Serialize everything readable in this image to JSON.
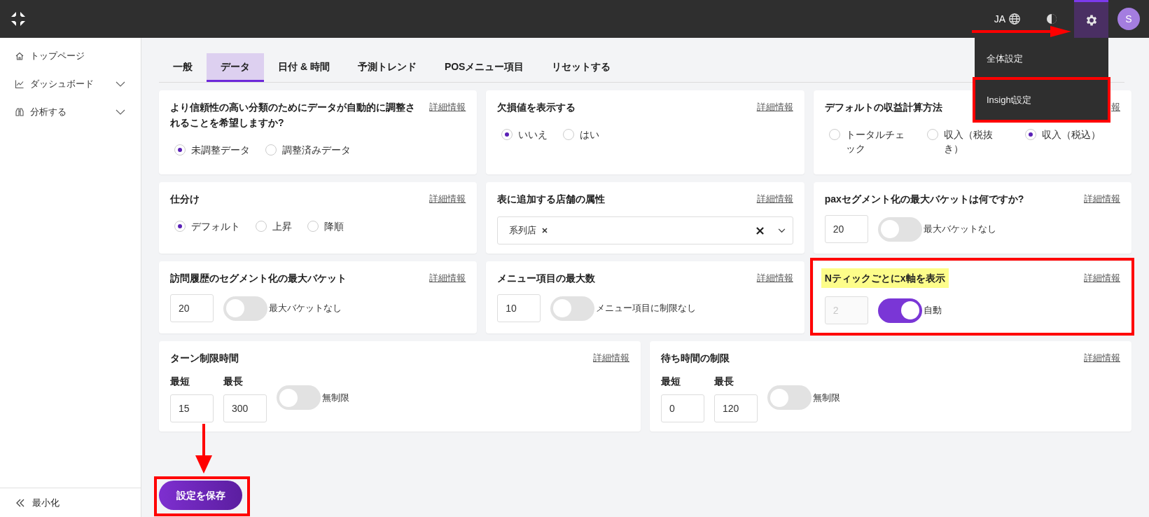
{
  "header": {
    "language": "JA",
    "avatar_initial": "S",
    "settings_menu": [
      {
        "label": "全体設定"
      },
      {
        "label": "Insight設定"
      }
    ]
  },
  "sidebar": {
    "items": [
      {
        "label": "トップページ",
        "expandable": false
      },
      {
        "label": "ダッシュボード",
        "expandable": true
      },
      {
        "label": "分析する",
        "expandable": true
      }
    ],
    "collapse_label": "最小化"
  },
  "tabs": [
    {
      "label": "一般",
      "selected": false
    },
    {
      "label": "データ",
      "selected": true
    },
    {
      "label": "日付 & 時間",
      "selected": false
    },
    {
      "label": "予測トレンド",
      "selected": false
    },
    {
      "label": "POSメニュー項目",
      "selected": false
    },
    {
      "label": "リセットする",
      "selected": false
    }
  ],
  "card_rows": [
    [
      {
        "kind": "radio",
        "title": "より信頼性の高い分類のためにデータが自動的に調整されることを希望しますか?",
        "highlighted": false,
        "info_link": "詳細情報",
        "options": [
          {
            "label": "未調整データ",
            "selected": true
          },
          {
            "label": "調整済みデータ",
            "selected": false
          }
        ]
      },
      {
        "kind": "radio",
        "title": "欠損値を表示する",
        "highlighted": false,
        "info_link": "詳細情報",
        "options": [
          {
            "label": "いいえ",
            "selected": true
          },
          {
            "label": "はい",
            "selected": false
          }
        ]
      },
      {
        "kind": "radio",
        "title": "デフォルトの収益計算方法",
        "highlighted": false,
        "info_link": "報",
        "options": [
          {
            "label": "トータルチェック",
            "selected": false
          },
          {
            "label": "収入（税抜き）",
            "selected": false
          },
          {
            "label": "収入（税込）",
            "selected": true
          }
        ]
      }
    ],
    [
      {
        "kind": "radio",
        "title": "仕分け",
        "highlighted": false,
        "info_link": "詳細情報",
        "options": [
          {
            "label": "デフォルト",
            "selected": true
          },
          {
            "label": "上昇",
            "selected": false
          },
          {
            "label": "降順",
            "selected": false
          }
        ]
      },
      {
        "kind": "tags",
        "title": "表に追加する店舗の属性",
        "highlighted": false,
        "info_link": "詳細情報",
        "tags": [
          {
            "label": "系列店"
          }
        ]
      },
      {
        "kind": "number_toggle",
        "title": "paxセグメント化の最大バケットは何ですか?",
        "highlighted": false,
        "info_link": "詳細情報",
        "value": "20",
        "disabled": false,
        "toggle": {
          "on": false,
          "label": "最大バケットなし"
        }
      }
    ],
    [
      {
        "kind": "number_toggle",
        "title": "訪問履歴のセグメント化の最大バケット",
        "highlighted": false,
        "info_link": "詳細情報",
        "value": "20",
        "disabled": false,
        "toggle": {
          "on": false,
          "label": "最大バケットなし"
        }
      },
      {
        "kind": "number_toggle",
        "title": "メニュー項目の最大数",
        "highlighted": false,
        "info_link": "詳細情報",
        "value": "10",
        "disabled": false,
        "toggle": {
          "on": false,
          "label": "メニュー項目に制限なし"
        }
      },
      {
        "kind": "number_toggle",
        "title": "Nティックごとにx軸を表示",
        "highlighted": true,
        "info_link": "詳細情報",
        "value": "2",
        "disabled": true,
        "toggle": {
          "on": true,
          "label": "自動"
        }
      }
    ],
    [
      {
        "kind": "range_toggle",
        "title": "ターン制限時間",
        "highlighted": false,
        "info_link": "詳細情報",
        "min_label": "最短",
        "min_value": "15",
        "max_label": "最長",
        "max_value": "300",
        "toggle": {
          "on": false,
          "label": "無制限"
        }
      },
      {
        "kind": "range_toggle",
        "title": "待ち時間の制限",
        "highlighted": false,
        "info_link": "詳細情報",
        "min_label": "最短",
        "min_value": "0",
        "max_label": "最長",
        "max_value": "120",
        "toggle": {
          "on": false,
          "label": "無制限"
        }
      }
    ]
  ],
  "save_button": "設定を保存"
}
